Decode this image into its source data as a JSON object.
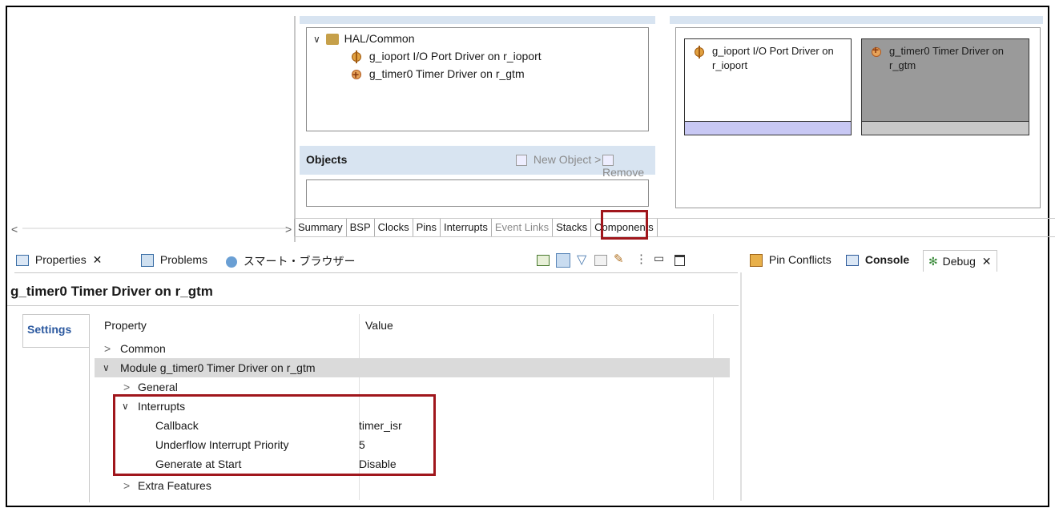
{
  "top_tree": {
    "group_label": "HAL/Common",
    "items": [
      {
        "label": "g_ioport I/O Port Driver on r_ioport",
        "icon": "plug-icon"
      },
      {
        "label": "g_timer0 Timer Driver on r_gtm",
        "icon": "timer-icon"
      }
    ]
  },
  "objects_panel": {
    "title": "Objects",
    "new_object": "New Object >",
    "remove": "Remove"
  },
  "stack_blocks": [
    {
      "label": "g_ioport I/O Port Driver on r_ioport"
    },
    {
      "label": "g_timer0 Timer Driver on r_gtm"
    }
  ],
  "config_tabs": [
    "Summary",
    "BSP",
    "Clocks",
    "Pins",
    "Interrupts",
    "Event Links",
    "Stacks",
    "Components"
  ],
  "config_tab_active": "Stacks",
  "bottom_left_tabs": [
    "Properties",
    "Problems",
    "スマート・ブラウザー"
  ],
  "bottom_right_tabs": [
    "Pin Conflicts",
    "Console",
    "Debug"
  ],
  "properties": {
    "title": "g_timer0 Timer Driver on r_gtm",
    "side_tab": "Settings",
    "col_property": "Property",
    "col_value": "Value",
    "rows": [
      {
        "label": "Common",
        "value": ""
      },
      {
        "label": "Module g_timer0 Timer Driver on r_gtm",
        "value": ""
      },
      {
        "label": "General",
        "value": ""
      },
      {
        "label": "Interrupts",
        "value": ""
      },
      {
        "label": "Callback",
        "value": "timer_isr"
      },
      {
        "label": "Underflow Interrupt Priority",
        "value": "5"
      },
      {
        "label": "Generate at Start",
        "value": "Disable"
      },
      {
        "label": "Extra Features",
        "value": ""
      }
    ]
  },
  "scroll": {
    "left": "<",
    "right": ">"
  },
  "colors": {
    "highlight_box": "#a0161c",
    "panel_blue": "#d8e4f1",
    "active_block": "#9a9a9a"
  }
}
